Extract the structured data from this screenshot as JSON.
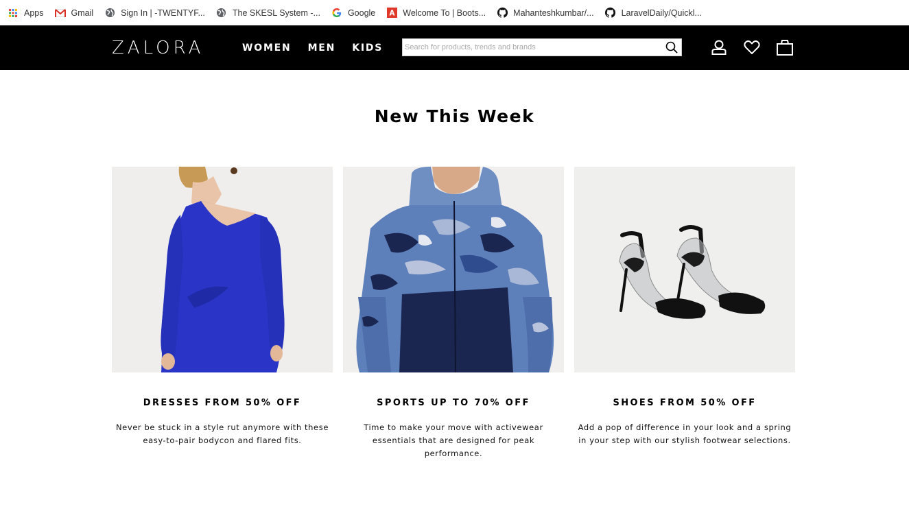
{
  "bookmarks": [
    {
      "label": "Apps",
      "icon": "apps-grid-icon"
    },
    {
      "label": "Gmail",
      "icon": "gmail-icon"
    },
    {
      "label": "Sign In | -TWENTYF...",
      "icon": "globe-icon"
    },
    {
      "label": "The SKESL System -...",
      "icon": "globe-icon"
    },
    {
      "label": "Google",
      "icon": "google-icon"
    },
    {
      "label": "Welcome To | Boots...",
      "icon": "bootsnipp-icon"
    },
    {
      "label": "Mahanteshkumbar/...",
      "icon": "github-icon"
    },
    {
      "label": "LaravelDaily/Quickl...",
      "icon": "github-icon"
    }
  ],
  "header": {
    "logo": "ZALORA",
    "nav": [
      "WOMEN",
      "MEN",
      "KIDS"
    ],
    "search_placeholder": "Search for products, trends and brands",
    "icons": [
      "account-icon",
      "wishlist-heart-icon",
      "shopping-bag-icon"
    ]
  },
  "main": {
    "title": "New This Week",
    "cards": [
      {
        "title": "DRESSES FROM 50% OFF",
        "description": "Never be stuck in a style rut anymore with these easy-to-pair bodycon and flared fits."
      },
      {
        "title": "SPORTS UP TO 70% OFF",
        "description": "Time to make your move with activewear essentials that are designed for peak performance."
      },
      {
        "title": "SHOES FROM 50% OFF",
        "description": "Add a pop of difference in your look and a spring in your step with our stylish footwear selections."
      }
    ]
  },
  "colors": {
    "header_bg": "#000000",
    "dress_blue": "#2a35c8",
    "jacket_navy": "#1b2650"
  }
}
